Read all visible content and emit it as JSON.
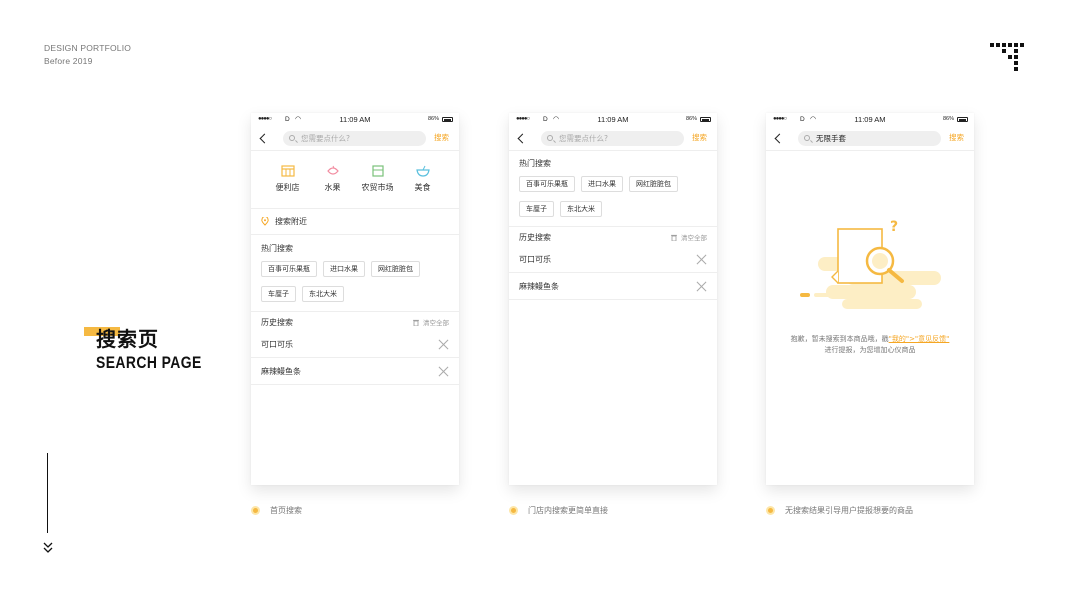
{
  "brand": {
    "line1": "DESIGN PORTFOLIO",
    "line2": "Before 2019"
  },
  "section": {
    "title_zh": "搜索页",
    "title_en": "SEARCH PAGE"
  },
  "status_bar": {
    "carrier": "D",
    "time": "11:09 AM",
    "battery": "86%"
  },
  "screen1": {
    "search_placeholder": "您需要点什么?",
    "search_button": "搜索",
    "categories": [
      {
        "label": "便利店",
        "icon": "store-icon",
        "color": "#f5b942"
      },
      {
        "label": "水果",
        "icon": "fruit-icon",
        "color": "#f28ca0"
      },
      {
        "label": "农贸市场",
        "icon": "market-icon",
        "color": "#7ac27a"
      },
      {
        "label": "美食",
        "icon": "food-icon",
        "color": "#5bc0de"
      }
    ],
    "nearby_label": "搜索附近",
    "hot_title": "热门搜索",
    "hot_tags": [
      "百事可乐果瓶",
      "进口水果",
      "网红脏脏包",
      "车厘子",
      "东北大米"
    ],
    "history_title": "历史搜索",
    "clear_all": "清空全部",
    "history": [
      "可口可乐",
      "麻辣鳗鱼条"
    ]
  },
  "screen2": {
    "search_placeholder": "您需要点什么?",
    "search_button": "搜索",
    "hot_title": "热门搜索",
    "hot_tags": [
      "百事可乐果瓶",
      "进口水果",
      "网红脏脏包",
      "车厘子",
      "东北大米"
    ],
    "history_title": "历史搜索",
    "clear_all": "清空全部",
    "history": [
      "可口可乐",
      "麻辣鳗鱼条"
    ]
  },
  "screen3": {
    "search_value": "无限手套",
    "search_button": "搜索",
    "empty_line1_a": "抱歉，暂未搜索到本商品哦，戳",
    "empty_link": "\"我的\">\"意见反馈\"",
    "empty_line2": "进行提报，为您增加心仪商品"
  },
  "captions": [
    "首页搜索",
    "门店内搜索更简单直接",
    "无搜索结果引导用户提报想要的商品"
  ],
  "colors": {
    "accent": "#f5a623",
    "accent_light": "#fde6a8"
  }
}
